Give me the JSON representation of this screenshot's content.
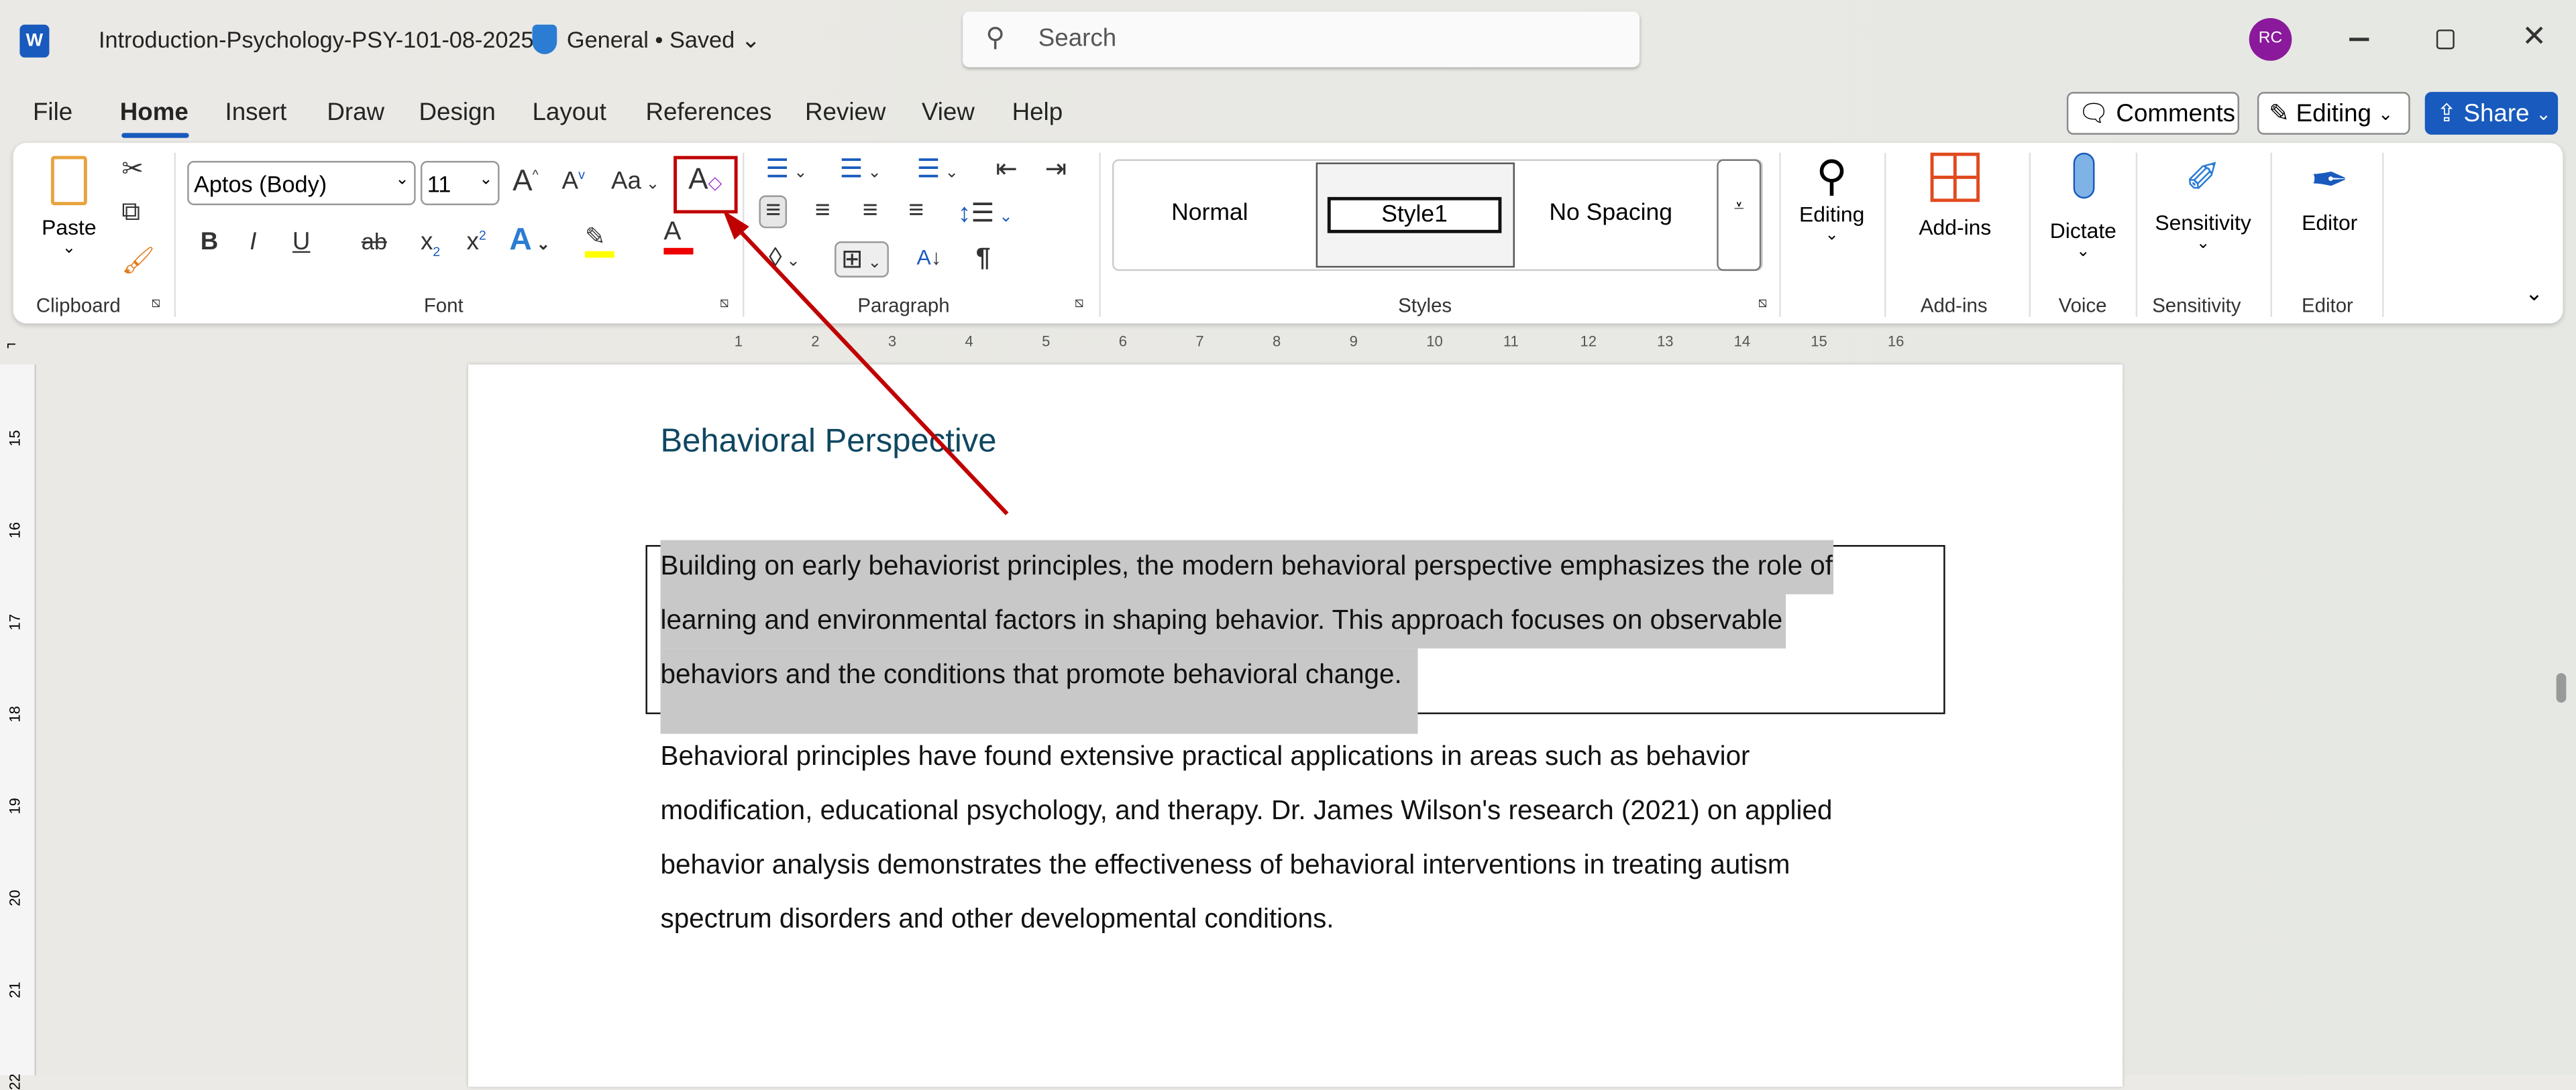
{
  "titlebar": {
    "doc_title": "Introduction-Psychology-PSY-101-08-2025",
    "label": "General",
    "status": "• Saved",
    "search_placeholder": "Search",
    "avatar": "RC",
    "app_icon": "W"
  },
  "tabs": [
    "File",
    "Home",
    "Insert",
    "Draw",
    "Design",
    "Layout",
    "References",
    "Review",
    "View",
    "Help"
  ],
  "actions": {
    "comments": "Comments",
    "editing": "Editing",
    "share": "Share"
  },
  "ribbon": {
    "clipboard": {
      "paste": "Paste",
      "label": "Clipboard"
    },
    "font": {
      "name": "Aptos (Body)",
      "size": "11",
      "case": "Aa",
      "bold": "B",
      "italic": "I",
      "underline": "U",
      "strike": "ab",
      "sub": "x",
      "sup": "x",
      "label": "Font"
    },
    "paragraph": {
      "label": "Paragraph",
      "pilcrow": "¶"
    },
    "styles": {
      "items": [
        "Normal",
        "Style1",
        "No Spacing"
      ],
      "label": "Styles"
    },
    "editing": {
      "button": "Editing"
    },
    "addins": {
      "button": "Add-ins",
      "label": "Add-ins"
    },
    "voice": {
      "button": "Dictate",
      "label": "Voice"
    },
    "sensitivity": {
      "button": "Sensitivity",
      "label": "Sensitivity"
    },
    "editor": {
      "button": "Editor",
      "label": "Editor"
    }
  },
  "ruler": {
    "h": [
      "1",
      "2",
      "3",
      "4",
      "5",
      "6",
      "7",
      "8",
      "9",
      "10",
      "11",
      "12",
      "13",
      "14",
      "15",
      "16"
    ],
    "v": [
      "15",
      "16",
      "17",
      "18",
      "19",
      "20",
      "21",
      "22"
    ]
  },
  "document": {
    "heading": "Behavioral Perspective",
    "para1": [
      "Building on early behaviorist principles, the modern behavioral perspective emphasizes the role of",
      "learning and environmental factors in shaping behavior. This approach focuses on observable",
      "behaviors and the conditions that promote behavioral change."
    ],
    "para2": [
      "Behavioral principles have found extensive practical applications in areas such as behavior",
      "modification, educational psychology, and therapy. Dr. James Wilson's research (2021) on applied",
      "behavior analysis demonstrates the effectiveness of behavioral interventions in treating autism",
      "spectrum disorders and other developmental conditions."
    ]
  },
  "colors": {
    "accent": "#185abd",
    "heading": "#0f4761",
    "highlight": "#c8c8c8",
    "annotation": "#c00000",
    "avatar": "#8a1a9b"
  }
}
